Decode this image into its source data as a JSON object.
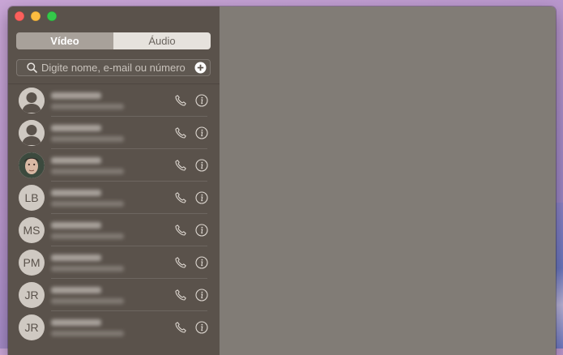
{
  "sidebar": {
    "segments": {
      "video_label": "Vídeo",
      "audio_label": "Áudio"
    },
    "search": {
      "placeholder": "Digite nome, e-mail ou número"
    },
    "contacts": [
      {
        "avatar": "placeholder",
        "initials": ""
      },
      {
        "avatar": "placeholder",
        "initials": ""
      },
      {
        "avatar": "photo",
        "initials": ""
      },
      {
        "avatar": "initials",
        "initials": "LB"
      },
      {
        "avatar": "initials",
        "initials": "MS"
      },
      {
        "avatar": "initials",
        "initials": "PM"
      },
      {
        "avatar": "initials",
        "initials": "JR"
      },
      {
        "avatar": "initials",
        "initials": "JR"
      }
    ]
  },
  "icons": [
    "search-icon",
    "add-contact-icon",
    "phone-icon",
    "info-icon",
    "person-silhouette-icon"
  ],
  "colors": {
    "close": "#fc605c",
    "minimize": "#fdbc40",
    "maximize": "#34c84a",
    "sidebar": "#5a524b",
    "video_area": "#817c76",
    "selected_segment": "#a8a19a"
  }
}
